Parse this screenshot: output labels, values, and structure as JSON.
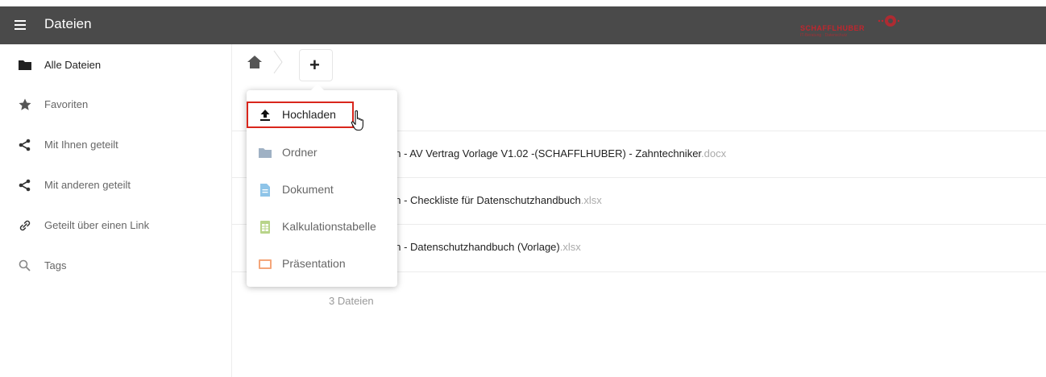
{
  "header": {
    "title": "Dateien",
    "brand_name": "SCHAFFLHUBER",
    "brand_tagline": "IT-Beratung · Datenschutz",
    "colors": {
      "bar": "#4a4a4a",
      "brand": "#c0262e"
    }
  },
  "sidebar": {
    "items": [
      {
        "label": "Alle Dateien",
        "icon": "folder-icon",
        "active": true
      },
      {
        "label": "Favoriten",
        "icon": "star-icon"
      },
      {
        "label": "Mit Ihnen geteilt",
        "icon": "share-icon"
      },
      {
        "label": "Mit anderen geteilt",
        "icon": "share-icon"
      },
      {
        "label": "Geteilt über einen Link",
        "icon": "link-icon"
      },
      {
        "label": "Tags",
        "icon": "search-icon"
      }
    ]
  },
  "toolbar": {
    "add_label": "+"
  },
  "new_menu": {
    "items": [
      {
        "label": "Hochladen",
        "icon": "upload-icon",
        "highlighted": true
      },
      {
        "label": "Ordner",
        "icon": "folder-icon"
      },
      {
        "label": "Dokument",
        "icon": "document-icon"
      },
      {
        "label": "Kalkulationstabelle",
        "icon": "spreadsheet-icon"
      },
      {
        "label": "Präsentation",
        "icon": "presentation-icon"
      }
    ],
    "highlight_color": "#d9261c"
  },
  "files": [
    {
      "name": "nn - AV Vertrag Vorlage V1.02 -(SCHAFFLHUBER) - Zahntechniker",
      "ext": ".docx"
    },
    {
      "name": "nn - Checkliste für Datenschutzhandbuch",
      "ext": ".xlsx"
    },
    {
      "name": "nn - Datenschutzhandbuch (Vorlage)",
      "ext": ".xlsx"
    }
  ],
  "summary": "3 Dateien"
}
